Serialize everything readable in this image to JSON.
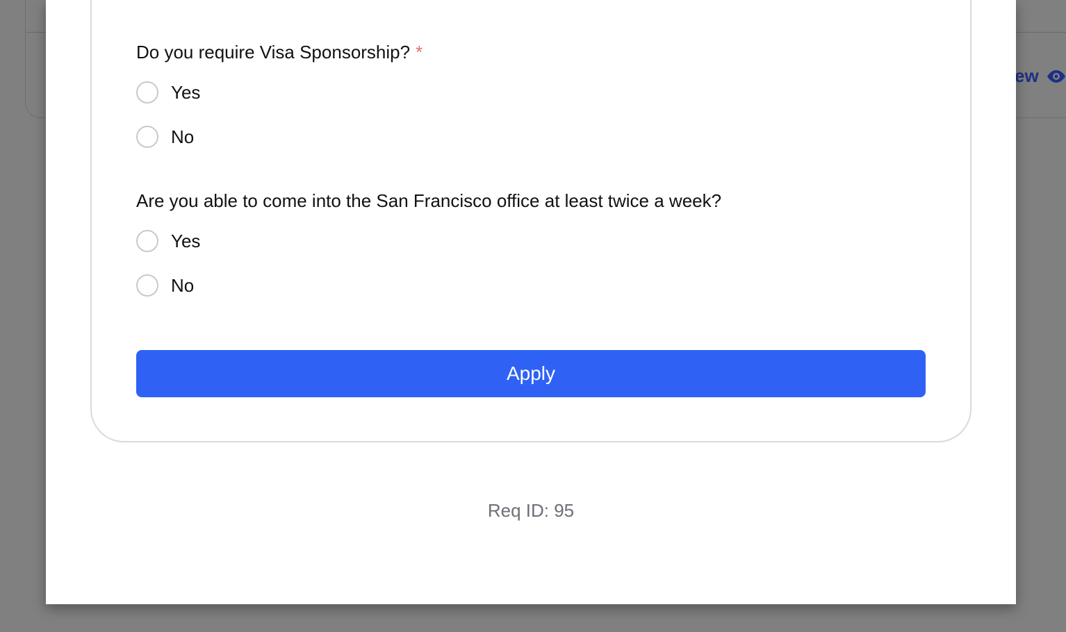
{
  "background": {
    "view_link_label": "ew",
    "view_link_icon": "eye-icon"
  },
  "form": {
    "question_1": {
      "label": "Do you require Visa Sponsorship?",
      "required_mark": "*",
      "options": [
        "Yes",
        "No"
      ]
    },
    "question_2": {
      "label": "Are you able to come into the San Francisco office at least twice a week?",
      "options": [
        "Yes",
        "No"
      ]
    },
    "apply_label": "Apply"
  },
  "footer": {
    "req_id": "Req ID: 95"
  },
  "colors": {
    "accent": "#2f62f4",
    "required": "#e07070",
    "overlay": "#808080"
  }
}
